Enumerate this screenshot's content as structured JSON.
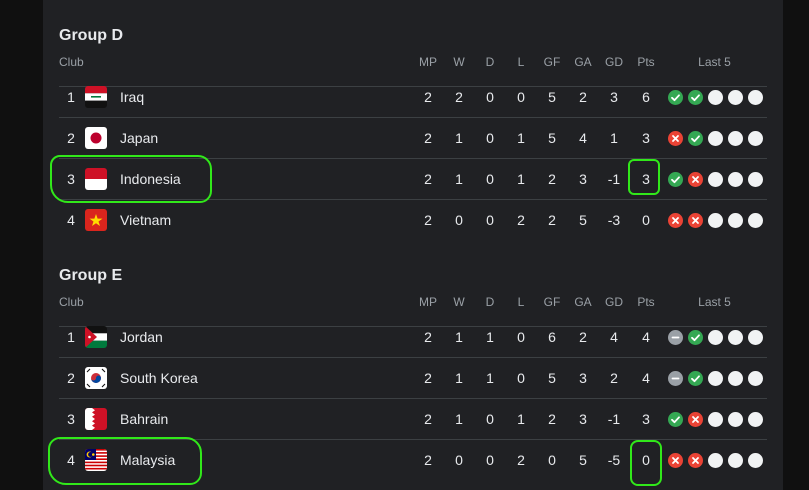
{
  "colors": {
    "win": "#34a853",
    "loss": "#ea4335",
    "draw": "#9aa0a6",
    "upcoming": "#f1f3f4",
    "highlight": "#31e81a"
  },
  "headers": {
    "club": "Club",
    "mp": "MP",
    "w": "W",
    "d": "D",
    "l": "L",
    "gf": "GF",
    "ga": "GA",
    "gd": "GD",
    "pts": "Pts",
    "last5": "Last 5"
  },
  "groups": [
    {
      "title": "Group D",
      "rows": [
        {
          "pos": "1",
          "club": "Iraq",
          "flag": "iraq-flag",
          "mp": "2",
          "w": "2",
          "d": "0",
          "l": "0",
          "gf": "5",
          "ga": "2",
          "gd": "3",
          "pts": "6",
          "last5": [
            "win",
            "win",
            "upcoming",
            "upcoming",
            "upcoming"
          ]
        },
        {
          "pos": "2",
          "club": "Japan",
          "flag": "japan-flag",
          "mp": "2",
          "w": "1",
          "d": "0",
          "l": "1",
          "gf": "5",
          "ga": "4",
          "gd": "1",
          "pts": "3",
          "last5": [
            "loss",
            "win",
            "upcoming",
            "upcoming",
            "upcoming"
          ]
        },
        {
          "pos": "3",
          "club": "Indonesia",
          "flag": "indonesia-flag",
          "mp": "2",
          "w": "1",
          "d": "0",
          "l": "1",
          "gf": "2",
          "ga": "3",
          "gd": "-1",
          "pts": "3",
          "last5": [
            "win",
            "loss",
            "upcoming",
            "upcoming",
            "upcoming"
          ]
        },
        {
          "pos": "4",
          "club": "Vietnam",
          "flag": "vietnam-flag",
          "mp": "2",
          "w": "0",
          "d": "0",
          "l": "2",
          "gf": "2",
          "ga": "5",
          "gd": "-3",
          "pts": "0",
          "last5": [
            "loss",
            "loss",
            "upcoming",
            "upcoming",
            "upcoming"
          ]
        }
      ]
    },
    {
      "title": "Group E",
      "rows": [
        {
          "pos": "1",
          "club": "Jordan",
          "flag": "jordan-flag",
          "mp": "2",
          "w": "1",
          "d": "1",
          "l": "0",
          "gf": "6",
          "ga": "2",
          "gd": "4",
          "pts": "4",
          "last5": [
            "draw",
            "win",
            "upcoming",
            "upcoming",
            "upcoming"
          ]
        },
        {
          "pos": "2",
          "club": "South Korea",
          "flag": "south-korea-flag",
          "mp": "2",
          "w": "1",
          "d": "1",
          "l": "0",
          "gf": "5",
          "ga": "3",
          "gd": "2",
          "pts": "4",
          "last5": [
            "draw",
            "win",
            "upcoming",
            "upcoming",
            "upcoming"
          ]
        },
        {
          "pos": "3",
          "club": "Bahrain",
          "flag": "bahrain-flag",
          "mp": "2",
          "w": "1",
          "d": "0",
          "l": "1",
          "gf": "2",
          "ga": "3",
          "gd": "-1",
          "pts": "3",
          "last5": [
            "win",
            "loss",
            "upcoming",
            "upcoming",
            "upcoming"
          ]
        },
        {
          "pos": "4",
          "club": "Malaysia",
          "flag": "malaysia-flag",
          "mp": "2",
          "w": "0",
          "d": "0",
          "l": "2",
          "gf": "0",
          "ga": "5",
          "gd": "-5",
          "pts": "0",
          "last5": [
            "loss",
            "loss",
            "upcoming",
            "upcoming",
            "upcoming"
          ]
        }
      ]
    }
  ]
}
